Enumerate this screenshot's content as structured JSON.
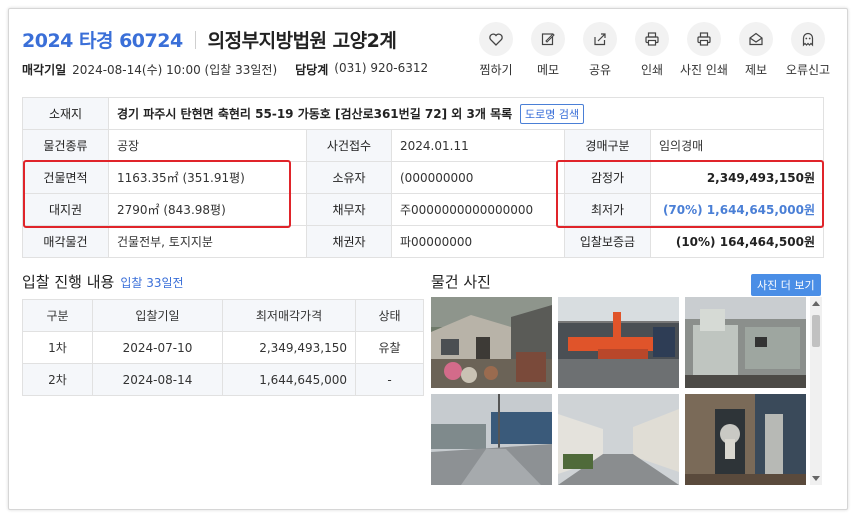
{
  "header": {
    "case_number": "2024 타경 60724",
    "court": "의정부지방법원 고양2계",
    "sale_date_label": "매각기일",
    "sale_date_value": "2024-08-14(수) 10:00 (입찰 33일전)",
    "dept_label": "담당계",
    "dept_phone": "(031) 920-6312"
  },
  "actions": [
    {
      "label": "찜하기",
      "icon": "heart-icon"
    },
    {
      "label": "메모",
      "icon": "memo-icon"
    },
    {
      "label": "공유",
      "icon": "share-icon"
    },
    {
      "label": "인쇄",
      "icon": "print-icon"
    },
    {
      "label": "사진 인쇄",
      "icon": "photo-print-icon"
    },
    {
      "label": "제보",
      "icon": "report-mail-icon"
    },
    {
      "label": "오류신고",
      "icon": "ghost-icon"
    }
  ],
  "info": {
    "location_label": "소재지",
    "location_value": "경기 파주시 탄현면 축현리 55-19 가동호 [검산로361번길 72] 외 3개 목록",
    "road_button": "도로명 검색",
    "type_label": "물건종류",
    "type_value": "공장",
    "received_label": "사건접수",
    "received_value": "2024.01.11",
    "auction_kind_label": "경매구분",
    "auction_kind_value": "임의경매",
    "building_area_label": "건물면적",
    "building_area_value": "1163.35㎡ (351.91평)",
    "owner_label": "소유자",
    "owner_value": "(000000000",
    "appraisal_label": "감정가",
    "appraisal_value": "2,349,493,150원",
    "land_right_label": "대지권",
    "land_right_value": "2790㎡ (843.98평)",
    "debtor_label": "채무자",
    "debtor_value": "주0000000000000000",
    "min_price_label": "최저가",
    "min_price_value": "(70%) 1,644,645,000원",
    "sale_item_label": "매각물건",
    "sale_item_value": "건물전부, 토지지분",
    "creditor_label": "채권자",
    "creditor_value": "파00000000",
    "deposit_label": "입찰보증금",
    "deposit_value": "(10%) 164,464,500원"
  },
  "bids": {
    "title": "입찰 진행 내용",
    "subtitle": "입찰 33일전",
    "headers": [
      "구분",
      "입찰기일",
      "최저매각가격",
      "상태"
    ],
    "rows": [
      {
        "round": "1차",
        "date": "2024-07-10",
        "price": "2,349,493,150",
        "status": "유찰"
      },
      {
        "round": "2차",
        "date": "2024-08-14",
        "price": "1,644,645,000",
        "status": "-"
      }
    ]
  },
  "photos": {
    "title": "물건 사진",
    "more_button": "사진 더 보기"
  },
  "colors": {
    "accent_blue": "#3a6fd8",
    "highlight_red": "#e0242a",
    "table_header_bg": "#f5f7fa"
  }
}
